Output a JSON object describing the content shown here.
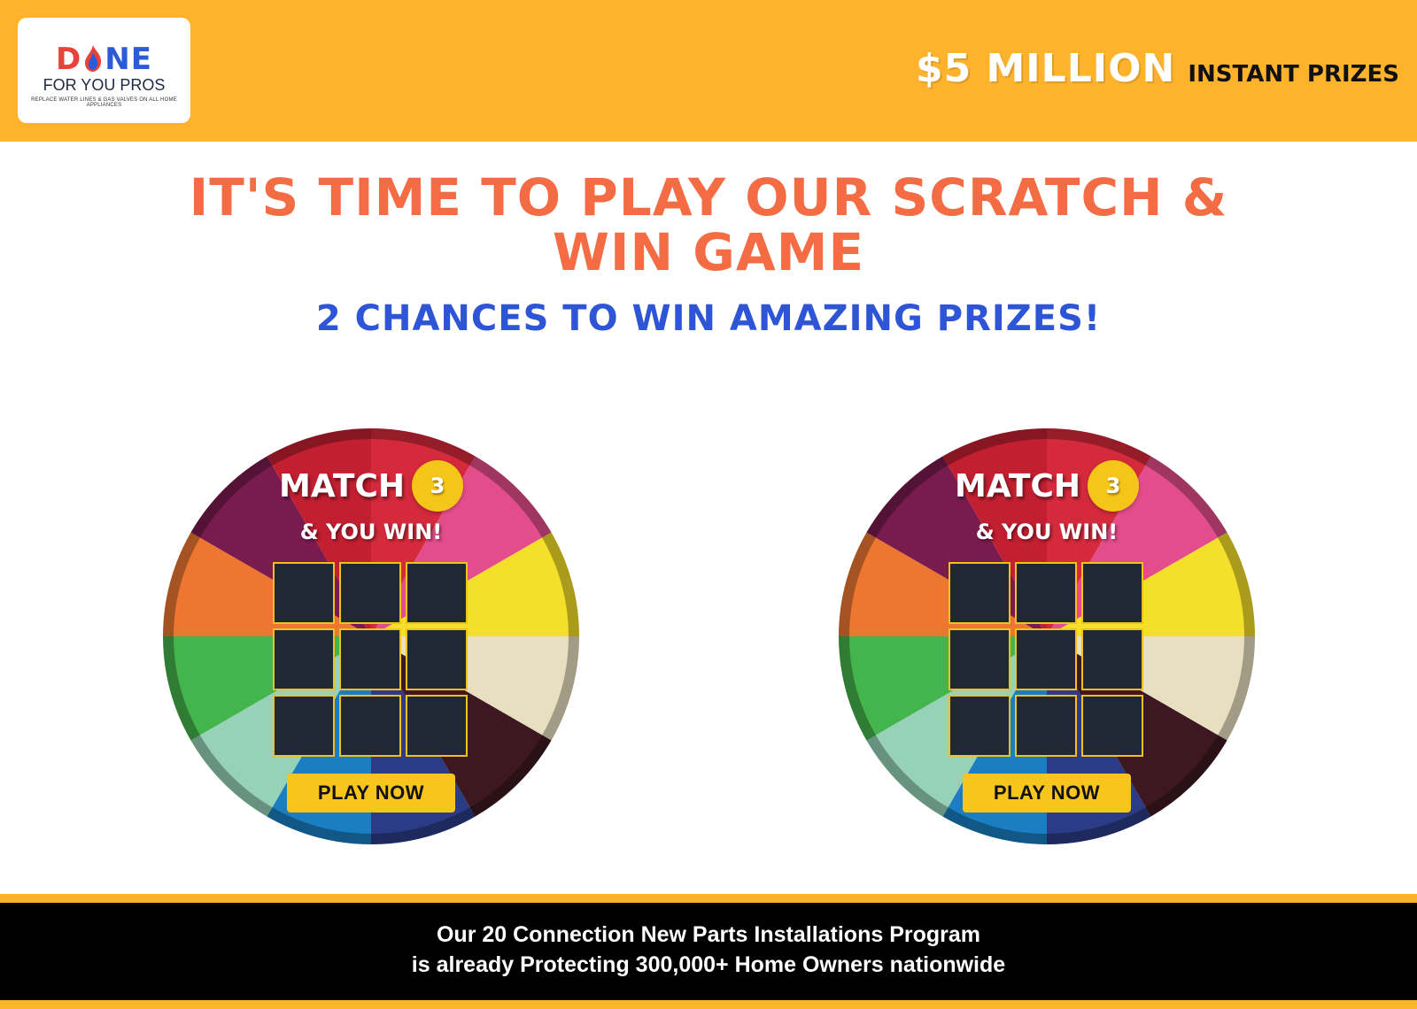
{
  "header": {
    "logo": {
      "word_left": "D",
      "word_right": "NE",
      "subtitle": "FOR YOU PROS",
      "tagline": "REPLACE WATER LINES & GAS VALVES ON ALL HOME APPLIANCES"
    },
    "prize_big": "$5 MILLION",
    "prize_small": "INSTANT PRIZES"
  },
  "hero": {
    "headline": "IT'S TIME TO PLAY OUR SCRATCH & WIN GAME",
    "subline": "2 CHANCES TO WIN AMAZING PRIZES!"
  },
  "games": [
    {
      "match_label": "MATCH",
      "match_number": "3",
      "win_label": "& YOU WIN!",
      "play_button": "PLAY NOW"
    },
    {
      "match_label": "MATCH",
      "match_number": "3",
      "win_label": "& YOU WIN!",
      "play_button": "PLAY NOW"
    }
  ],
  "footer": {
    "line1": "Our 20 Connection New Parts Installations Program",
    "line2": "is already Protecting 300,000+ Home Owners nationwide"
  },
  "colors": {
    "header_bg": "#ffb32c",
    "headline": "#f46c43",
    "subline": "#2d55d6",
    "cell_bg": "#202735",
    "cell_border": "#f2c21b",
    "button": "#f8c51d",
    "wheel_segments": [
      "#d42a3c",
      "#e44d8c",
      "#f4df2a",
      "#e8dfc0",
      "#3d1822",
      "#2c3b86",
      "#1b7ec2",
      "#96d1b8",
      "#44b44c",
      "#ed7731",
      "#7a1b4f",
      "#c21f31"
    ]
  }
}
